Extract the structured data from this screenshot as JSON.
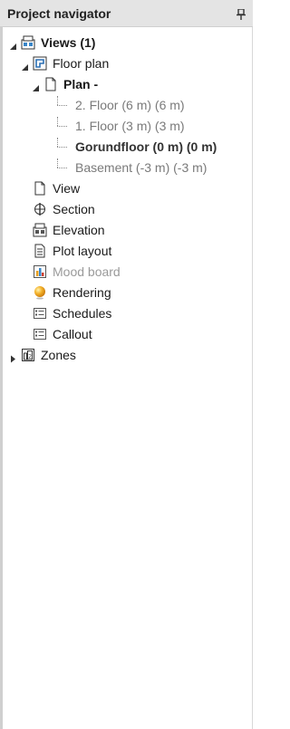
{
  "panel": {
    "title": "Project navigator"
  },
  "tree": {
    "views": "Views (1)",
    "floor_plan": "Floor plan",
    "plan": "Plan -",
    "floors": [
      "2. Floor (6 m) (6 m)",
      "1. Floor (3 m) (3 m)",
      "Gorundfloor (0 m) (0 m)",
      "Basement (-3 m) (-3 m)"
    ],
    "view": "View",
    "section": "Section",
    "elevation": "Elevation",
    "plot_layout": "Plot layout",
    "mood_board": "Mood board",
    "rendering": "Rendering",
    "schedules": "Schedules",
    "callout": "Callout",
    "zones": "Zones"
  }
}
